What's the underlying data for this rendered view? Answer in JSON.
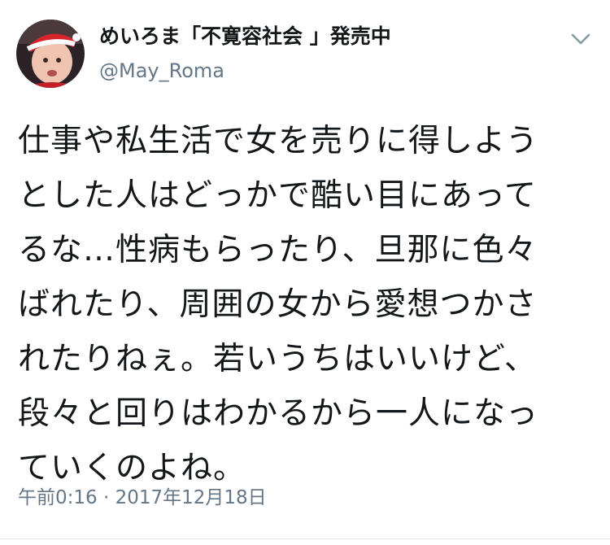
{
  "author": {
    "display_name": "めいろま「不寛容社会 」発売中",
    "handle": "@May_Roma",
    "avatar_icon": "baby-in-santa-hat-avatar"
  },
  "menu_icon": "chevron-down-icon",
  "tweet": {
    "lines": [
      "仕事や私生活で女を売りに得しよう",
      "とした人はどっかで酷い目にあって",
      "るな…性病もらったり、旦那に色々",
      "ばれたり、周囲の女から愛想つかさ",
      "れたりねぇ。若いうちはいいけど、",
      "段々と回りはわかるから一人になっ",
      "ていくのよね。"
    ],
    "timestamp": "午前0:16 · 2017年12月18日"
  },
  "colors": {
    "text": "#14171a",
    "secondary": "#657786",
    "divider": "#e1e8ed"
  }
}
